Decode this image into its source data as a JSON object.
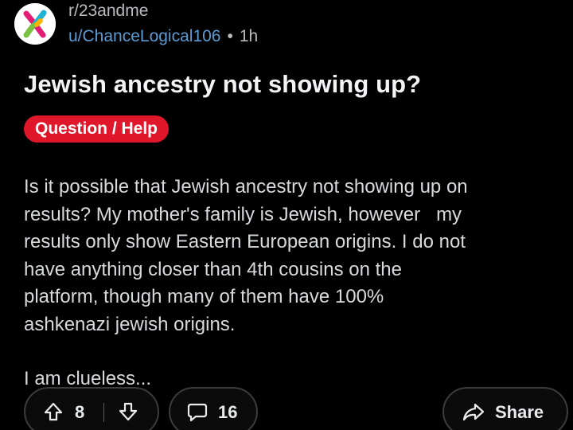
{
  "post": {
    "subreddit": "r/23andme",
    "username": "u/ChanceLogical106",
    "separator": "•",
    "age": "1h",
    "title": "Jewish ancestry not showing up?",
    "flair": "Question / Help",
    "body_lines": [
      "Is it possible that Jewish ancestry not showing up on",
      "results? My mother's family is Jewish, however   my",
      "results only show Eastern European origins. I do not",
      "have anything closer than 4th cousins on the",
      "platform, though many of them have 100%",
      "ashkenazi jewish origins."
    ],
    "closing_line": "I am clueless..."
  },
  "actions": {
    "upvote_count": "8",
    "comment_count": "16",
    "share_label": "Share"
  },
  "icons": {
    "avatar": "23andme-logo",
    "upvote": "upvote-arrow-icon",
    "downvote": "downvote-arrow-icon",
    "comment": "comment-bubble-icon",
    "share": "share-arrow-icon"
  },
  "colors": {
    "background": "#000000",
    "username": "#5b9bd5",
    "flair": "#e0162b",
    "text": "#d7dadc"
  }
}
